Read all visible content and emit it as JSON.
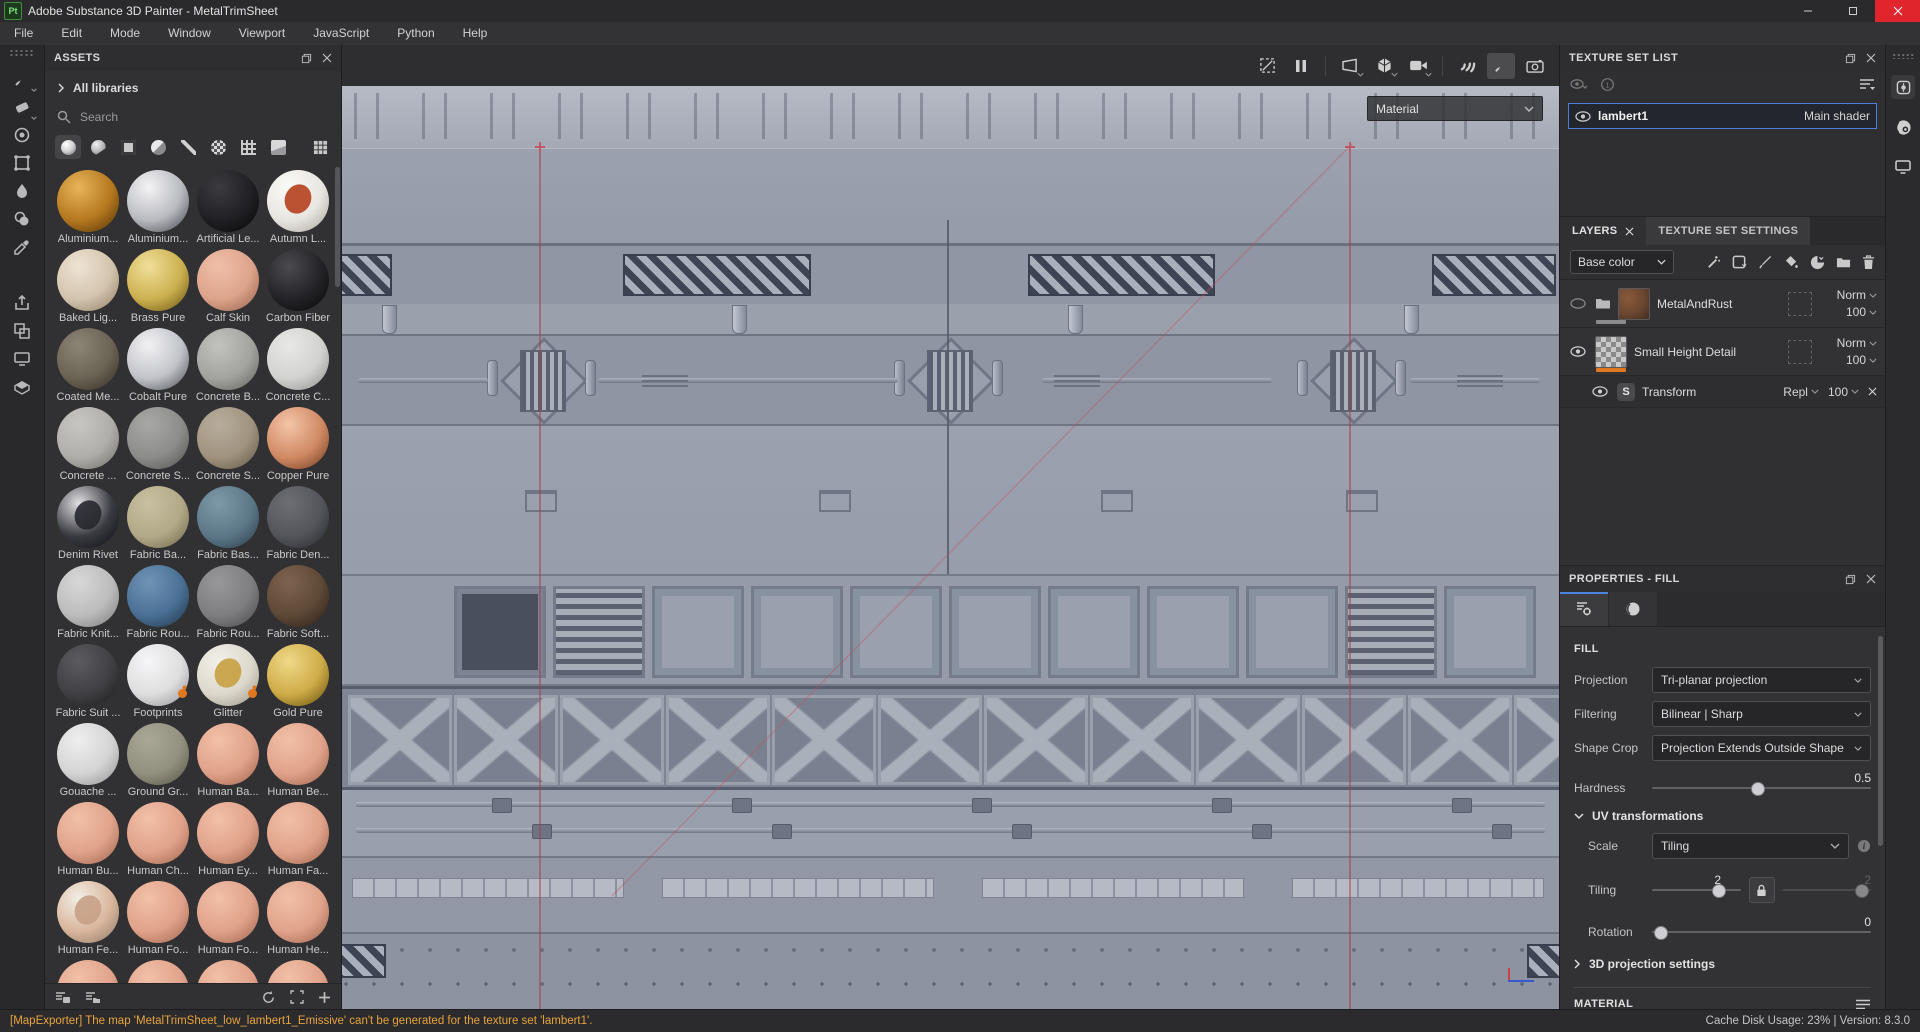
{
  "window": {
    "title": "Adobe Substance 3D Painter - MetalTrimSheet",
    "logo": "Pt"
  },
  "menu": {
    "items": [
      "File",
      "Edit",
      "Mode",
      "Window",
      "Viewport",
      "JavaScript",
      "Python",
      "Help"
    ]
  },
  "tool_strip": {
    "tools": [
      "paint-tool",
      "eraser-tool",
      "projection-tool",
      "polygon-fill-tool",
      "smudge-tool",
      "clone-tool",
      "material-picker-tool"
    ],
    "lower": [
      "export-icon",
      "resources-icon",
      "display-settings-icon",
      "shelf-icon"
    ]
  },
  "assets_panel": {
    "title": "ASSETS",
    "library_selector": "All libraries",
    "search_placeholder": "Search",
    "filters": [
      "materials",
      "smart-materials",
      "smart-masks",
      "filters",
      "brushes",
      "alphas",
      "patterns",
      "textures"
    ],
    "selected_filter": "materials",
    "items": [
      {
        "label": "Aluminium...",
        "c1": "#e8b45a",
        "c2": "#b5781f",
        "c3": "#5f3c0a"
      },
      {
        "label": "Aluminium...",
        "c1": "#f4f4f6",
        "c2": "#b9bac0",
        "c3": "#55565e"
      },
      {
        "label": "Artificial Le...",
        "c1": "#3c3c40",
        "c2": "#202024",
        "c3": "#0a0a0c"
      },
      {
        "label": "Autumn L...",
        "c1": "#fafaf8",
        "c2": "#e8e6e0",
        "c3": "#b0aea6",
        "accent": "#b5401e"
      },
      {
        "label": "Baked Lig...",
        "c1": "#eee3d2",
        "c2": "#d3c4ae",
        "c3": "#98876f"
      },
      {
        "label": "Brass Pure",
        "c1": "#f0e09a",
        "c2": "#cdb050",
        "c3": "#77611a"
      },
      {
        "label": "Calf Skin",
        "c1": "#f0bfa8",
        "c2": "#dda38b",
        "c3": "#a06a52"
      },
      {
        "label": "Carbon Fiber",
        "c1": "#4a4a50",
        "c2": "#232327",
        "c3": "#0c0c0e"
      },
      {
        "label": "Coated Me...",
        "c1": "#8c8474",
        "c2": "#6b6354",
        "c3": "#3b352a"
      },
      {
        "label": "Cobalt Pure",
        "c1": "#f2f2f4",
        "c2": "#c2c3c9",
        "c3": "#5e5f66"
      },
      {
        "label": "Concrete B...",
        "c1": "#c2c2be",
        "c2": "#a3a39f",
        "c3": "#6b6b67"
      },
      {
        "label": "Concrete C...",
        "c1": "#e8e8e6",
        "c2": "#d2d2d0",
        "c3": "#989896"
      },
      {
        "label": "Concrete ...",
        "c1": "#c8c6c2",
        "c2": "#b0aeaa",
        "c3": "#787672"
      },
      {
        "label": "Concrete S...",
        "c1": "#a8a8a6",
        "c2": "#8c8c8a",
        "c3": "#5a5a58"
      },
      {
        "label": "Concrete S...",
        "c1": "#b8ad9d",
        "c2": "#a0937f",
        "c3": "#6a5f4e"
      },
      {
        "label": "Copper Pure",
        "c1": "#f4c4a8",
        "c2": "#d08a64",
        "c3": "#7e4628"
      },
      {
        "label": "Denim Rivet",
        "c1": "#e0e0e2",
        "c2": "#3a3a42",
        "c3": "#131318",
        "accent": "#26262e"
      },
      {
        "label": "Fabric Ba...",
        "c1": "#c9c0a2",
        "c2": "#b2a988",
        "c3": "#776f52"
      },
      {
        "label": "Fabric Bas...",
        "c1": "#7e99a8",
        "c2": "#5c7888",
        "c3": "#324452"
      },
      {
        "label": "Fabric Den...",
        "c1": "#6e6f75",
        "c2": "#54555b",
        "c3": "#2e2f33"
      },
      {
        "label": "Fabric Knit...",
        "c1": "#d8d8d8",
        "c2": "#bcbcbc",
        "c3": "#848484"
      },
      {
        "label": "Fabric Rou...",
        "c1": "#6f94b5",
        "c2": "#4a7095",
        "c3": "#253c52"
      },
      {
        "label": "Fabric Rou...",
        "c1": "#98989a",
        "c2": "#7e7e80",
        "c3": "#505052"
      },
      {
        "label": "Fabric Soft...",
        "c1": "#7e6450",
        "c2": "#5e4836",
        "c3": "#32241a"
      },
      {
        "label": "Fabric Suit ...",
        "c1": "#5c5c60",
        "c2": "#404044",
        "c3": "#202022"
      },
      {
        "label": "Footprints",
        "c1": "#f6f6f8",
        "c2": "#dededf",
        "c3": "#9c9c9e",
        "badge": "#e07820"
      },
      {
        "label": "Glitter",
        "c1": "#f2f0ea",
        "c2": "#dcd8cc",
        "c3": "#a09c90",
        "badge": "#e07820",
        "accent": "#c8a040"
      },
      {
        "label": "Gold Pure",
        "c1": "#f0d888",
        "c2": "#ceac48",
        "c3": "#735a14"
      },
      {
        "label": "Gouache ...",
        "c1": "#efefef",
        "c2": "#d4d4d4",
        "c3": "#9a9a9a"
      },
      {
        "label": "Ground Gr...",
        "c1": "#aaa796",
        "c2": "#92907e",
        "c3": "#5e5c4e"
      },
      {
        "label": "Human Ba...",
        "c1": "#f2c0a8",
        "c2": "#e0a28a",
        "c3": "#a86c54"
      },
      {
        "label": "Human Be...",
        "c1": "#f2c0a8",
        "c2": "#e0a28a",
        "c3": "#a86c54"
      },
      {
        "label": "Human Bu...",
        "c1": "#f2c0a8",
        "c2": "#e0a28a",
        "c3": "#a86c54"
      },
      {
        "label": "Human Ch...",
        "c1": "#f2c0a8",
        "c2": "#e0a28a",
        "c3": "#a86c54"
      },
      {
        "label": "Human Ey...",
        "c1": "#f2c0a8",
        "c2": "#e0a28a",
        "c3": "#a86c54"
      },
      {
        "label": "Human Fa...",
        "c1": "#f2c0a8",
        "c2": "#e0a28a",
        "c3": "#a86c54"
      },
      {
        "label": "Human Fe...",
        "c1": "#f2eee6",
        "c2": "#d9b69c",
        "c3": "#98826e",
        "accent": "#c8a086"
      },
      {
        "label": "Human Fo...",
        "c1": "#f2c0a8",
        "c2": "#e0a28a",
        "c3": "#a86c54"
      },
      {
        "label": "Human Fo...",
        "c1": "#f2c0a8",
        "c2": "#e0a28a",
        "c3": "#a86c54"
      },
      {
        "label": "Human He...",
        "c1": "#f2c0a8",
        "c2": "#e0a28a",
        "c3": "#a86c54"
      }
    ],
    "partial_row": [
      {
        "c1": "#f2c0a8",
        "c2": "#e0a28a",
        "c3": "#a86c54"
      },
      {
        "c1": "#f2c0a8",
        "c2": "#e0a28a",
        "c3": "#a86c54"
      },
      {
        "c1": "#f2c0a8",
        "c2": "#e0a28a",
        "c3": "#a86c54"
      },
      {
        "c1": "#f2c0a8",
        "c2": "#e0a28a",
        "c3": "#a86c54"
      }
    ]
  },
  "viewport": {
    "material_label": "Material"
  },
  "texture_set_list": {
    "title": "TEXTURE SET LIST",
    "row": {
      "name": "lambert1",
      "shader": "Main shader"
    }
  },
  "layers_panel": {
    "tab_layers": "LAYERS",
    "tab_settings": "TEXTURE SET SETTINGS",
    "channel": "Base color",
    "layers": [
      {
        "name": "MetalAndRust",
        "kind": "group",
        "visible": false,
        "blend": "Norm",
        "opacity": "100",
        "bar": "#8a8a8c"
      },
      {
        "name": "Small Height Detail",
        "kind": "fill",
        "visible": true,
        "blend": "Norm",
        "opacity": "100",
        "bar": "#e07820"
      },
      {
        "name": "Transform",
        "kind": "effect",
        "visible": true,
        "blend": "Repl",
        "opacity": "100"
      }
    ]
  },
  "properties_panel": {
    "title": "PROPERTIES - FILL",
    "section": "FILL",
    "fields": [
      {
        "label": "Projection",
        "value": "Tri-planar projection"
      },
      {
        "label": "Filtering",
        "value": "Bilinear | Sharp"
      },
      {
        "label": "Shape Crop",
        "value": "Projection Extends Outside Shape"
      }
    ],
    "hardness_label": "Hardness",
    "hardness_value": "0.5",
    "uv_label": "UV transformations",
    "scale_label": "Scale",
    "scale_value": "Tiling",
    "tiling_label": "Tiling",
    "tiling_value1": "2",
    "tiling_value2": "2",
    "rotation_label": "Rotation",
    "rotation_value": "0",
    "proj3d_label": "3D projection settings",
    "material_label": "MATERIAL"
  },
  "status_bar": {
    "message": "[MapExporter] The map 'MetalTrimSheet_low_lambert1_Emissive' can't be generated for the texture set 'lambert1'.",
    "right": "Cache Disk Usage:   23% | Version: 8.3.0"
  },
  "colors": {
    "accent_blue": "#4a80d8",
    "accent_orange": "#e07820",
    "status_orange": "#e8a33d",
    "viewport_base": "#9aa0ac"
  }
}
